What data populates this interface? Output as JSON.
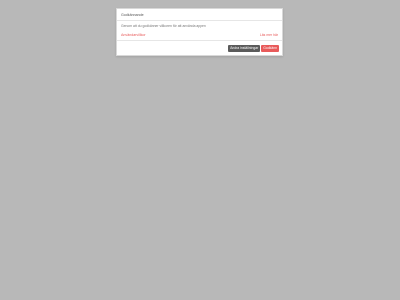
{
  "modal": {
    "title": "Godkännande",
    "body_text": "Genom att du godkänner villkoren för att använda appen",
    "terms_link": "Användarvillkor",
    "read_more_link": "Läs mer här"
  },
  "footer": {
    "decline_label": "Ändra inställningar",
    "accept_label": "Godkänn"
  },
  "colors": {
    "accent": "#e85a5a",
    "secondary_button": "#5b5b5b",
    "backdrop": "#b8b8b8"
  }
}
